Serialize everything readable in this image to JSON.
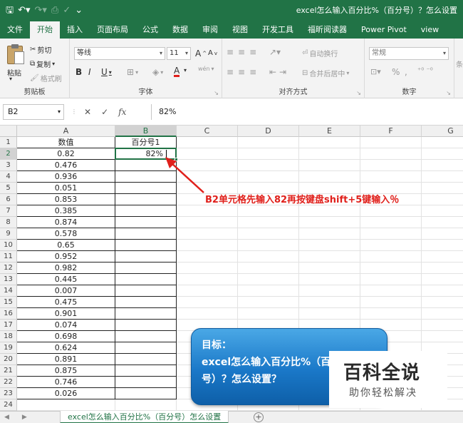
{
  "titlebar": {
    "save_icon": "save-icon",
    "undo_icon": "undo-icon",
    "title": "excel怎么输入百分比%（百分号）？怎么设置"
  },
  "tabs": [
    "文件",
    "开始",
    "插入",
    "页面布局",
    "公式",
    "数据",
    "审阅",
    "视图",
    "开发工具",
    "福昕阅读器",
    "Power Pivot",
    "view"
  ],
  "active_tab": "开始",
  "ribbon": {
    "clipboard": {
      "paste": "粘贴",
      "cut": "剪切",
      "copy": "复制",
      "format_painter": "格式刷",
      "label": "剪贴板"
    },
    "font": {
      "name": "等线",
      "size": "11",
      "grow": "A",
      "shrink": "A",
      "bold": "B",
      "italic": "I",
      "underline": "U",
      "color": "A",
      "wen": "wén",
      "label": "字体"
    },
    "align": {
      "wrap": "自动换行",
      "merge": "合并后居中",
      "label": "对齐方式"
    },
    "number": {
      "format": "常规",
      "percent": "%",
      "comma": ",",
      "label": "数字"
    },
    "styles": {
      "cond": "条"
    }
  },
  "formula_bar": {
    "name_box": "B2",
    "cancel": "✕",
    "enter": "✓",
    "fx": "fx",
    "value": "82%"
  },
  "columns": [
    "A",
    "B",
    "C",
    "D",
    "E",
    "F",
    "G"
  ],
  "rows": [
    "1",
    "2",
    "3",
    "4",
    "5",
    "6",
    "7",
    "8",
    "9",
    "10",
    "11",
    "12",
    "13",
    "14",
    "15",
    "16",
    "17",
    "18",
    "19",
    "20",
    "21",
    "22",
    "23",
    "24"
  ],
  "cells": {
    "A": [
      "数值",
      "0.82",
      "0.476",
      "0.936",
      "0.051",
      "0.853",
      "0.385",
      "0.874",
      "0.578",
      "0.65",
      "0.952",
      "0.982",
      "0.445",
      "0.007",
      "0.475",
      "0.901",
      "0.074",
      "0.698",
      "0.624",
      "0.891",
      "0.875",
      "0.746",
      "0.026"
    ],
    "B1": "百分号1",
    "B2": "82%"
  },
  "annotation": "B2单元格先输入82再按键盘shift+5键输入％",
  "bubble": {
    "title": "目标：",
    "line1": "excel怎么输入百分比%（百分",
    "line2": "号）？怎么设置？"
  },
  "watermark": {
    "big": "百科全说",
    "small": "助你轻松解决"
  },
  "sheet": {
    "tab": "excel怎么输入百分比%（百分号）怎么设置",
    "add": "+"
  },
  "colors": {
    "excel_green": "#217346",
    "annotation_red": "#e0201b",
    "bubble_blue": "#1a78c8"
  }
}
